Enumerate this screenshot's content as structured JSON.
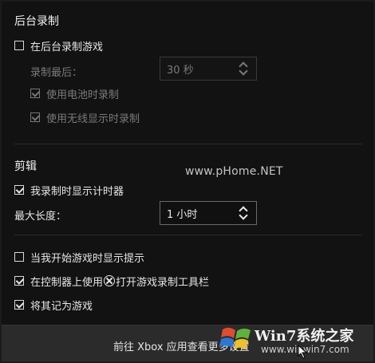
{
  "sections": {
    "background_recording": {
      "title": "后台录制",
      "record_in_background": "在后台录制游戏",
      "record_last_label": "录制最后：",
      "record_last_value": "30 秒",
      "record_on_battery": "使用电池时录制",
      "record_on_wireless_display": "使用无线显示时录制"
    },
    "clips": {
      "title": "剪辑",
      "show_timer": "我录制时显示计时器",
      "max_length_label": "最大长度：",
      "max_length_value": "1 小时"
    },
    "other": {
      "show_tips": "当我开始游戏时显示提示",
      "open_gamebar_prefix": "在控制器上使用",
      "open_gamebar_suffix": "打开游戏录制工具栏",
      "remember_as_game": "将其记为游戏"
    }
  },
  "footer": {
    "link": "前往 Xbox 应用查看更多设置"
  },
  "watermark": {
    "url": "www.pHome.NET",
    "logo": "Win7系统之家",
    "logo_sub": "www.winwin7.com"
  },
  "states": {
    "record_in_background": false,
    "record_on_battery": true,
    "record_on_wireless_display": true,
    "show_timer": true,
    "show_tips": false,
    "open_gamebar": true,
    "remember_as_game": true
  },
  "colors": {
    "background": "#121212",
    "footer": "#2b2b2b",
    "text": "#e6e6e6",
    "disabled_text": "#7a7a7a"
  },
  "icons": {
    "xbox": "xbox-logo-icon",
    "cursor": "mouse-cursor-icon",
    "logo": "windows-flag-logo"
  }
}
